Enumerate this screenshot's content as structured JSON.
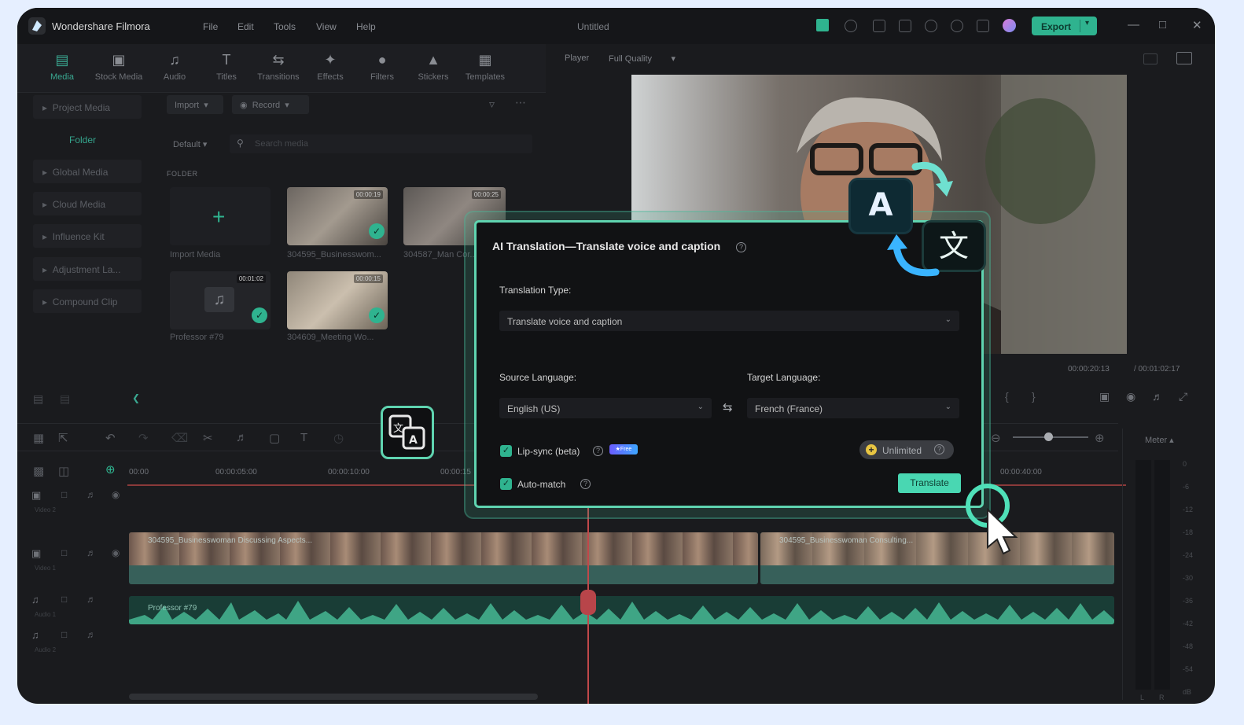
{
  "app": {
    "name": "Wondershare Filmora",
    "document_title": "Untitled"
  },
  "menu": [
    "File",
    "Edit",
    "Tools",
    "View",
    "Help"
  ],
  "export_label": "Export",
  "media_tabs": [
    {
      "label": "Media",
      "icon": "media-icon",
      "active": true
    },
    {
      "label": "Stock Media",
      "icon": "stock-media-icon",
      "active": false
    },
    {
      "label": "Audio",
      "icon": "music-note-icon",
      "active": false
    },
    {
      "label": "Titles",
      "icon": "title-t-icon",
      "active": false
    },
    {
      "label": "Transitions",
      "icon": "transition-icon",
      "active": false
    },
    {
      "label": "Effects",
      "icon": "effects-icon",
      "active": false
    },
    {
      "label": "Filters",
      "icon": "filters-icon",
      "active": false
    },
    {
      "label": "Stickers",
      "icon": "stickers-icon",
      "active": false
    },
    {
      "label": "Templates",
      "icon": "templates-icon",
      "active": false
    }
  ],
  "sidebar": {
    "items": [
      "Project Media",
      "Global Media",
      "Cloud Media",
      "Influence Kit",
      "Adjustment La...",
      "Compound Clip"
    ],
    "folder": "Folder"
  },
  "media_bin": {
    "import_label": "Import",
    "record_label": "Record",
    "sort_label": "Default",
    "search_placeholder": "Search media",
    "folder_header": "FOLDER",
    "import_media_label": "Import Media",
    "items": [
      {
        "name": "304595_Businesswom...",
        "duration": "00:00:19"
      },
      {
        "name": "304587_Man Cor...",
        "duration": "00:00:25"
      },
      {
        "name": "Professor #79",
        "duration": "00:01:02"
      },
      {
        "name": "304609_Meeting Wo...",
        "duration": "00:00:15"
      }
    ]
  },
  "player": {
    "label": "Player",
    "quality": "Full Quality",
    "current_time": "00:00:20:13",
    "total_time": "/ 00:01:02:17"
  },
  "timeline": {
    "ruler": [
      "00:00",
      "00:00:05:00",
      "00:00:10:00",
      "00:00:15",
      "00:00:40:00"
    ],
    "tracks": [
      "Video 2",
      "Video 1",
      "Audio 1",
      "Audio 2"
    ],
    "clip1": "304595_Businesswoman Discussing Aspects...",
    "clip2": "304595_Businesswoman Consulting...",
    "audio_clip": "Professor #79"
  },
  "meter": {
    "label": "Meter",
    "scale": [
      "0",
      "-6",
      "-12",
      "-18",
      "-24",
      "-30",
      "-36",
      "-42",
      "-48",
      "-54",
      "dB"
    ],
    "channels": [
      "L",
      "R"
    ]
  },
  "dialog": {
    "title": "AI Translation—Translate voice and caption",
    "translation_type_label": "Translation Type:",
    "translation_type_value": "Translate voice and caption",
    "source_label": "Source Language:",
    "source_value": "English (US)",
    "target_label": "Target Language:",
    "target_value": "French (France)",
    "lip_sync_label": "Lip-sync (beta)",
    "lip_sync_checked": true,
    "free_badge": "★Free",
    "auto_match_label": "Auto-match",
    "auto_match_checked": true,
    "credits_label": "Unlimited",
    "translate_button": "Translate"
  },
  "decor": {
    "bubble_latin": "A",
    "bubble_cjk": "文"
  },
  "colors": {
    "accent": "#2fb38f",
    "dialog_border": "#5fd4b0",
    "background": "#e6efff"
  }
}
